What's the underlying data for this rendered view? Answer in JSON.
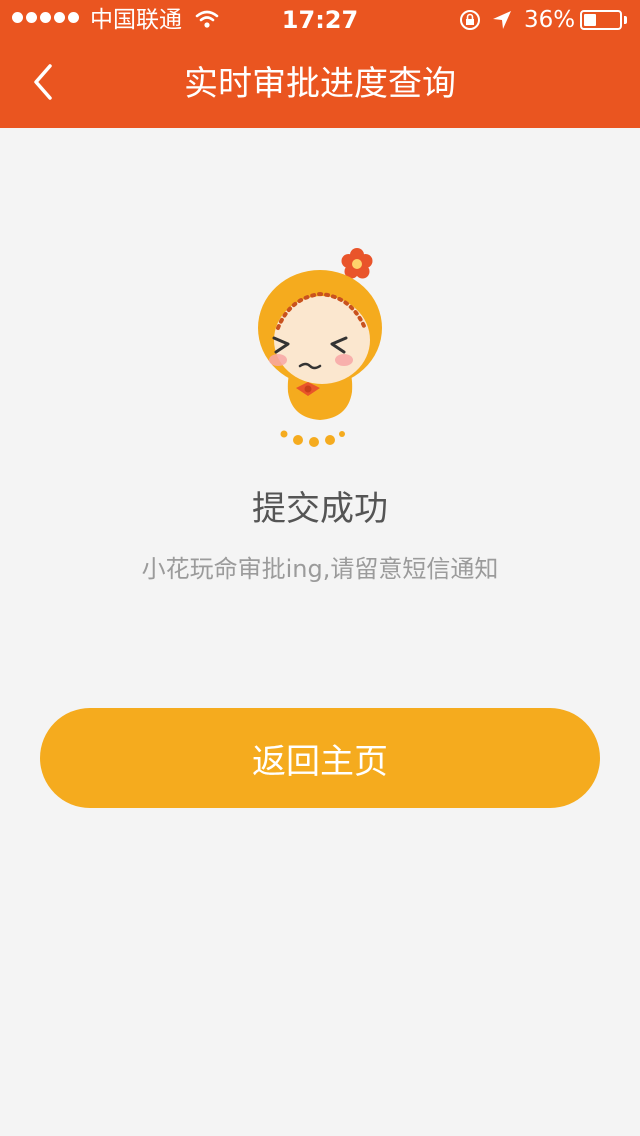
{
  "status_bar": {
    "carrier": "中国联通",
    "time": "17:27",
    "battery_percent": "36%",
    "battery_level": 0.36
  },
  "nav": {
    "title": "实时审批进度查询",
    "back_icon": "chevron-left-icon"
  },
  "result": {
    "title": "提交成功",
    "message": "小花玩命审批ing,请留意短信通知"
  },
  "actions": {
    "home_label": "返回主页"
  },
  "colors": {
    "header": "#ea5520",
    "button": "#f5ab1e",
    "background": "#f4f4f4"
  }
}
